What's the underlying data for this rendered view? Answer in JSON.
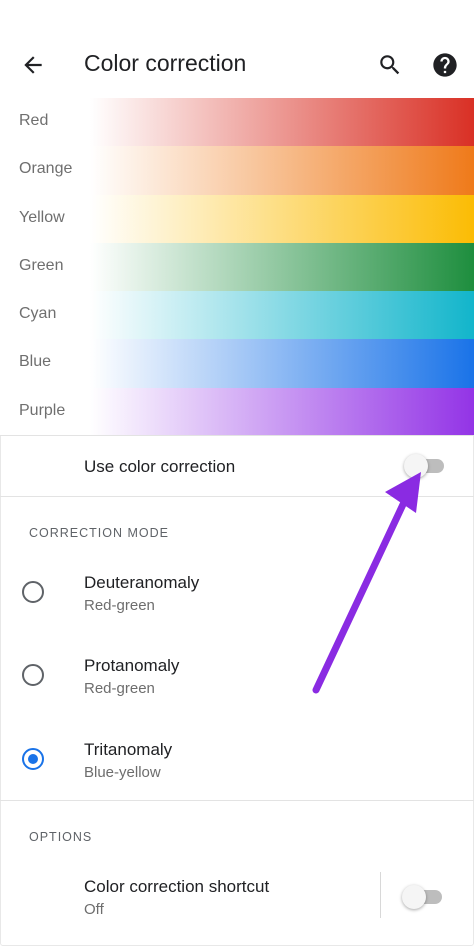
{
  "appbar": {
    "title": "Color correction",
    "back_icon": "arrow-left-icon",
    "search_icon": "search-icon",
    "help_icon": "help-icon"
  },
  "preview": {
    "rows": [
      {
        "label": "Red",
        "color": "#d93025"
      },
      {
        "label": "Orange",
        "color": "#ef7a1a"
      },
      {
        "label": "Yellow",
        "color": "#fbbc04"
      },
      {
        "label": "Green",
        "color": "#1e8e3e"
      },
      {
        "label": "Cyan",
        "color": "#12b5cb"
      },
      {
        "label": "Blue",
        "color": "#1a73e8"
      },
      {
        "label": "Purple",
        "color": "#9334e6"
      }
    ]
  },
  "use_color_correction": {
    "label": "Use color correction",
    "enabled": false
  },
  "correction_mode": {
    "header": "CORRECTION MODE",
    "options": [
      {
        "title": "Deuteranomaly",
        "subtitle": "Red-green",
        "selected": false
      },
      {
        "title": "Protanomaly",
        "subtitle": "Red-green",
        "selected": false
      },
      {
        "title": "Tritanomaly",
        "subtitle": "Blue-yellow",
        "selected": true
      }
    ]
  },
  "options": {
    "header": "OPTIONS",
    "shortcut": {
      "title": "Color correction shortcut",
      "subtitle": "Off",
      "enabled": false
    }
  },
  "annotation": {
    "arrow_color": "#8a2be2"
  }
}
